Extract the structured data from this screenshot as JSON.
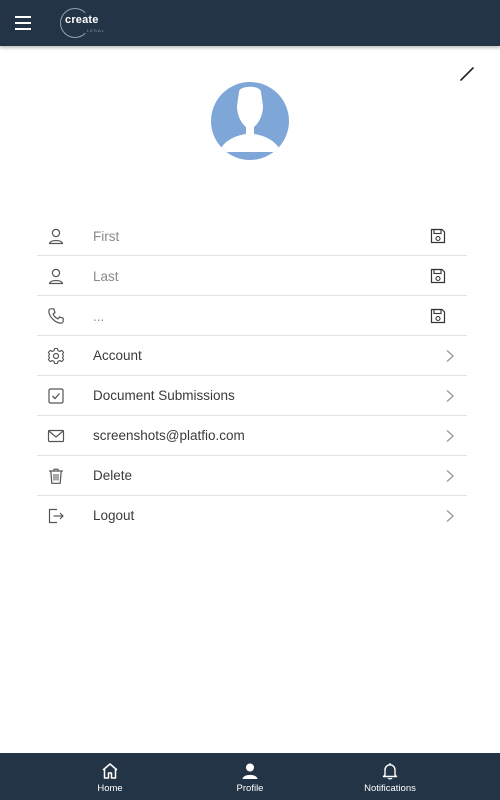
{
  "header": {
    "logo_text": "create",
    "logo_subtext": "LEGAL"
  },
  "profile": {
    "fields": [
      {
        "icon": "user-icon",
        "placeholder": "First",
        "value": ""
      },
      {
        "icon": "user-icon",
        "placeholder": "Last",
        "value": ""
      },
      {
        "icon": "phone-icon",
        "placeholder": "...",
        "value": ""
      }
    ],
    "links": [
      {
        "icon": "gear-icon",
        "label": "Account"
      },
      {
        "icon": "checkbox-icon",
        "label": "Document Submissions"
      },
      {
        "icon": "mail-icon",
        "label": "screenshots@platfio.com"
      },
      {
        "icon": "trash-icon",
        "label": "Delete"
      },
      {
        "icon": "logout-icon",
        "label": "Logout"
      }
    ]
  },
  "bottom_nav": {
    "items": [
      {
        "icon": "home-icon",
        "label": "Home"
      },
      {
        "icon": "person-icon",
        "label": "Profile",
        "active": true
      },
      {
        "icon": "bell-icon",
        "label": "Notifications"
      }
    ]
  },
  "colors": {
    "bar_background": "#243447",
    "avatar_background": "#7ea7d8",
    "divider": "#e2e2e2"
  }
}
